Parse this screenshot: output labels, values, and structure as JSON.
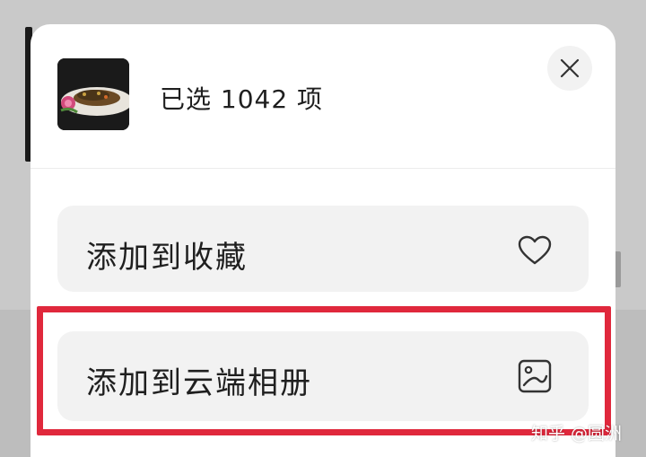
{
  "header": {
    "selection_text": "已选 1042 项"
  },
  "options": [
    {
      "label": "添加到收藏",
      "icon": "heart-icon"
    },
    {
      "label": "添加到云端相册",
      "icon": "cloud-album-image-icon"
    }
  ],
  "watermark": "知乎 @圆洲",
  "colors": {
    "highlight": "#e0283c",
    "sheet": "#ffffff",
    "option_bg": "#f2f2f2",
    "backdrop": "#c9c9c9"
  }
}
